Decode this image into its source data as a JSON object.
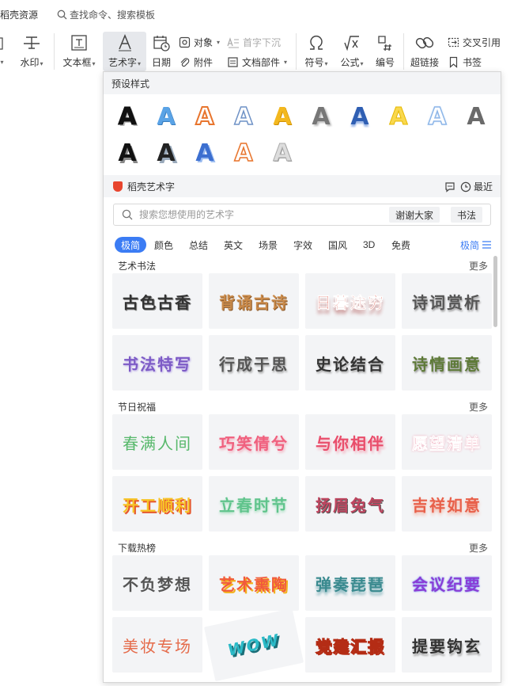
{
  "topbar": {
    "resource_label": "稻壳资源",
    "search_text": "查找命令、搜索模板"
  },
  "ribbon": {
    "partial_left_caret": "▾",
    "watermark": "水印",
    "textbox": "文本框",
    "wordart": "艺术字",
    "date": "日期",
    "object": "对象",
    "attachment": "附件",
    "dropcap": "首字下沉",
    "docparts": "文档部件",
    "symbol": "符号",
    "formula": "公式",
    "numbering": "编号",
    "hyperlink": "超链接",
    "crossref": "交叉引用",
    "bookmark": "书签"
  },
  "panel": {
    "preset_title": "预设样式",
    "preset_glyph": "A",
    "brand_title": "稻壳艺术字",
    "recent_label": "最近",
    "search_placeholder": "搜索您想使用的艺术字",
    "chip1": "谢谢大家",
    "chip2": "书法",
    "categories": [
      "极简",
      "颜色",
      "总结",
      "英文",
      "场景",
      "字效",
      "国风",
      "3D",
      "免费"
    ],
    "filter_label": "极简",
    "more_label": "更多",
    "groups": [
      {
        "title": "艺术书法",
        "items": [
          "古色古香",
          "背诵古诗",
          "日暮途穷",
          "诗词赏析",
          "书法特写",
          "行成于思",
          "史论结合",
          "诗情画意"
        ]
      },
      {
        "title": "节日祝福",
        "items": [
          "春满人间",
          "巧笑倩兮",
          "与你相伴",
          "愿望清单",
          "开工顺利",
          "立春时节",
          "扬眉兔气",
          "吉祥如意"
        ]
      },
      {
        "title": "下载热榜",
        "items": [
          "不负梦想",
          "艺术熏陶",
          "弹奏琵琶",
          "会议纪要",
          "美妆专场",
          "WOW",
          "党建汇报",
          "提要钩玄"
        ]
      }
    ]
  },
  "colors": {
    "accent": "#3b7cf4",
    "brand": "#e8452e",
    "panel_header": "#f3f4f6"
  }
}
